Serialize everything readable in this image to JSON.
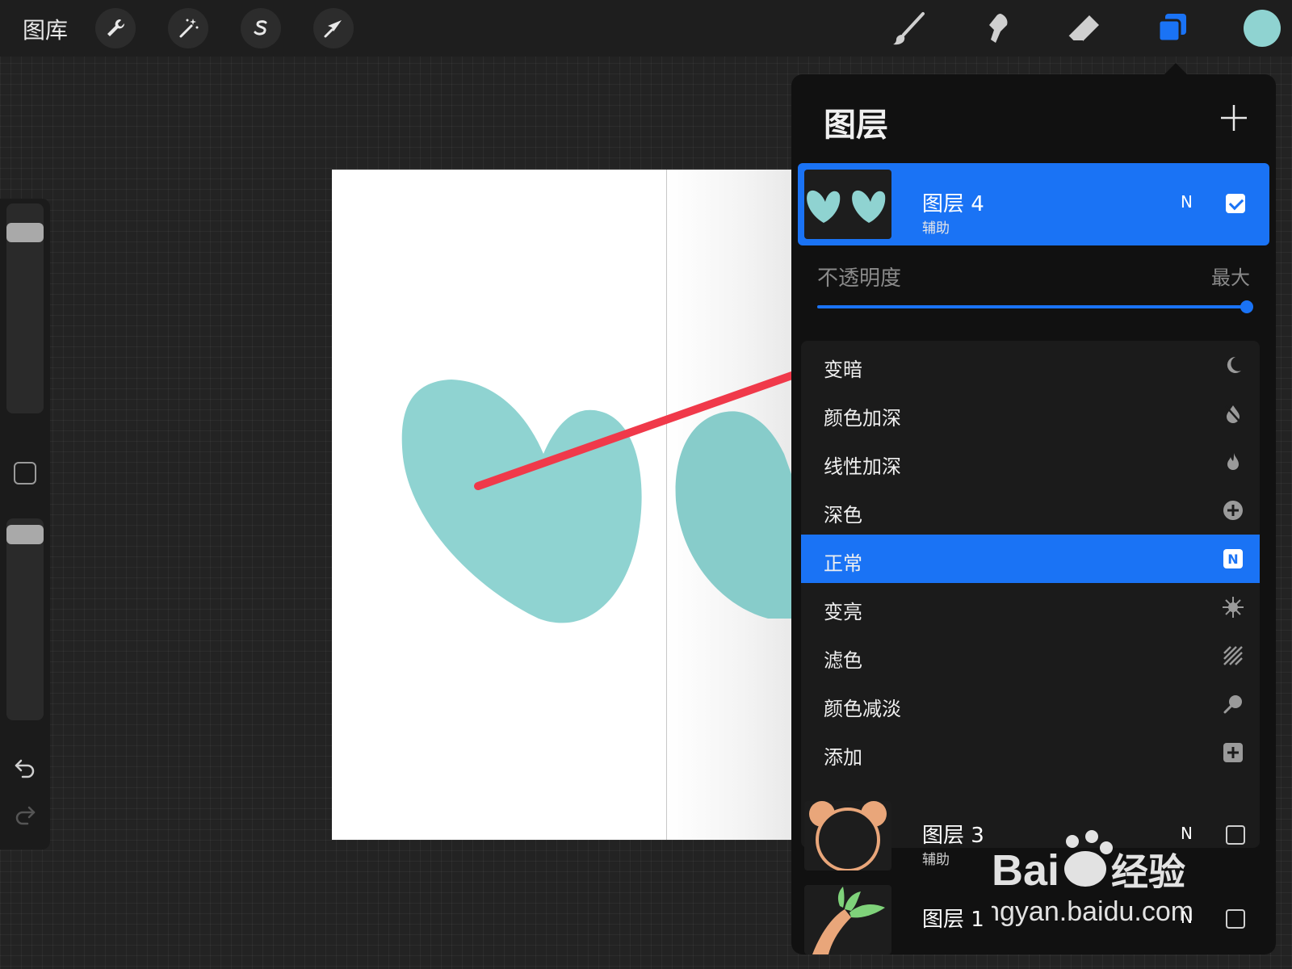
{
  "toolbar": {
    "gallery_label": "图库",
    "left_tools": [
      {
        "icon": "wrench-icon"
      },
      {
        "icon": "magic-wand-icon"
      },
      {
        "icon": "selection-s-icon"
      },
      {
        "icon": "transform-arrow-icon"
      }
    ],
    "right_tools": [
      {
        "icon": "brush-icon"
      },
      {
        "icon": "smudge-icon"
      },
      {
        "icon": "eraser-icon"
      },
      {
        "icon": "layers-icon"
      }
    ],
    "current_color": "#8fd3d1"
  },
  "colors": {
    "accent": "#1a73f5",
    "heart": "#8fd3d1",
    "annotation_arrow": "#f0394a"
  },
  "layers_panel": {
    "title": "图层",
    "add_icon": "plus-icon",
    "layers": [
      {
        "name": "图层 4",
        "sub": "辅助",
        "mode": "N",
        "visible": true,
        "active": true
      },
      {
        "name": "图层 3",
        "sub": "辅助",
        "mode": "N",
        "visible": false,
        "active": false
      },
      {
        "name": "图层 1",
        "sub": "",
        "mode": "N",
        "visible": false,
        "active": false
      }
    ],
    "opacity": {
      "label": "不透明度",
      "value_label": "最大",
      "value": 1.0
    },
    "blend_modes": [
      {
        "label": "变暗",
        "icon": "moon-icon",
        "selected": false
      },
      {
        "label": "颜色加深",
        "icon": "burn-icon",
        "selected": false
      },
      {
        "label": "线性加深",
        "icon": "flame-icon",
        "selected": false
      },
      {
        "label": "深色",
        "icon": "plus-circle-icon",
        "selected": false
      },
      {
        "label": "正常",
        "icon": "n-badge-icon",
        "selected": true,
        "badge": "N"
      },
      {
        "label": "变亮",
        "icon": "sun-icon",
        "selected": false
      },
      {
        "label": "滤色",
        "icon": "hatch-icon",
        "selected": false
      },
      {
        "label": "颜色减淡",
        "icon": "dodge-icon",
        "selected": false
      },
      {
        "label": "添加",
        "icon": "plus-square-icon",
        "selected": false
      }
    ]
  },
  "watermark": {
    "brand": "Bai",
    "brand_cn": "经验",
    "url": "jingyan.baidu.com"
  }
}
